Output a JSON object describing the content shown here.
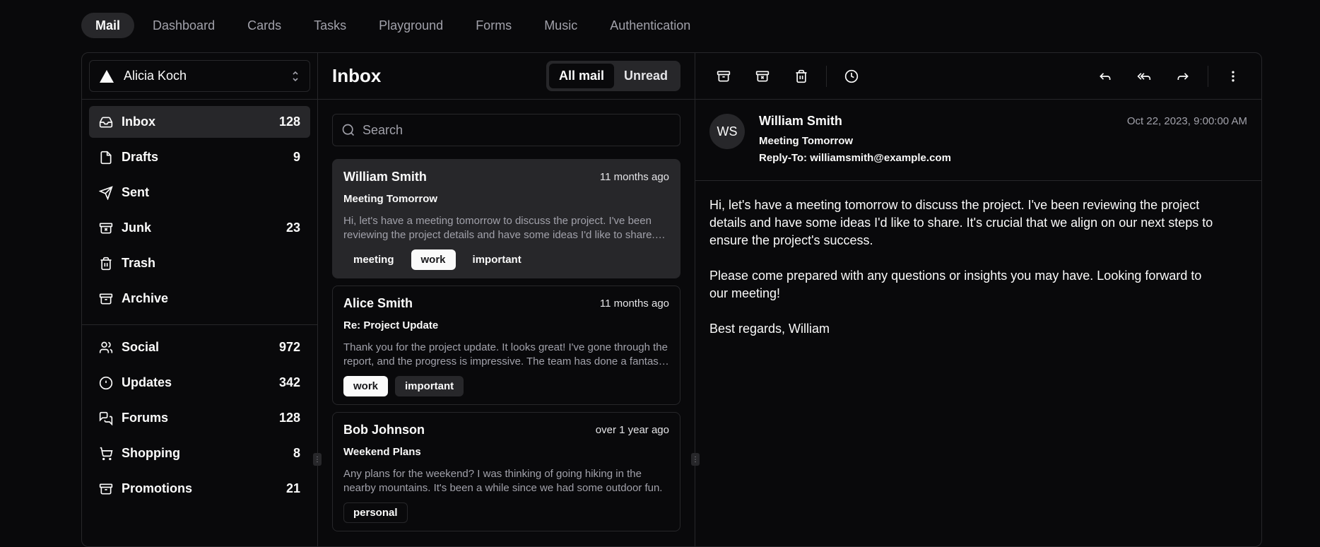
{
  "nav_tabs": [
    "Mail",
    "Dashboard",
    "Cards",
    "Tasks",
    "Playground",
    "Forms",
    "Music",
    "Authentication"
  ],
  "account": {
    "name": "Alicia Koch"
  },
  "sidebar": {
    "primary": [
      {
        "label": "Inbox",
        "count": "128",
        "icon": "inbox-icon"
      },
      {
        "label": "Drafts",
        "count": "9",
        "icon": "file-icon"
      },
      {
        "label": "Sent",
        "count": "",
        "icon": "send-icon"
      },
      {
        "label": "Junk",
        "count": "23",
        "icon": "archive-x-icon"
      },
      {
        "label": "Trash",
        "count": "",
        "icon": "trash-icon"
      },
      {
        "label": "Archive",
        "count": "",
        "icon": "archive-icon"
      }
    ],
    "secondary": [
      {
        "label": "Social",
        "count": "972",
        "icon": "users-icon"
      },
      {
        "label": "Updates",
        "count": "342",
        "icon": "alert-circle-icon"
      },
      {
        "label": "Forums",
        "count": "128",
        "icon": "messages-icon"
      },
      {
        "label": "Shopping",
        "count": "8",
        "icon": "cart-icon"
      },
      {
        "label": "Promotions",
        "count": "21",
        "icon": "archive-icon"
      }
    ]
  },
  "list": {
    "title": "Inbox",
    "toggle": {
      "all": "All mail",
      "unread": "Unread"
    },
    "search_placeholder": "Search",
    "mails": [
      {
        "from": "William Smith",
        "date": "11 months ago",
        "subject": "Meeting Tomorrow",
        "preview": "Hi, let's have a meeting tomorrow to discuss the project. I've been reviewing the project details and have some ideas I'd like to share. It's crucial that we align on our next steps to ensure the project's success.",
        "tags": [
          "meeting",
          "work",
          "important"
        ]
      },
      {
        "from": "Alice Smith",
        "date": "11 months ago",
        "subject": "Re: Project Update",
        "preview": "Thank you for the project update. It looks great! I've gone through the report, and the progress is impressive. The team has done a fantastic job, and I appreciate the hard work everyone has put in.",
        "tags": [
          "work",
          "important"
        ]
      },
      {
        "from": "Bob Johnson",
        "date": "over 1 year ago",
        "subject": "Weekend Plans",
        "preview": "Any plans for the weekend? I was thinking of going hiking in the nearby mountains. It's been a while since we had some outdoor fun.",
        "tags": [
          "personal"
        ]
      }
    ]
  },
  "reader": {
    "initials": "WS",
    "from": "William Smith",
    "subject": "Meeting Tomorrow",
    "reply_to": "Reply-To: williamsmith@example.com",
    "date": "Oct 22, 2023, 9:00:00 AM",
    "paragraphs": [
      "Hi, let's have a meeting tomorrow to discuss the project. I've been reviewing the project details and have some ideas I'd like to share. It's crucial that we align on our next steps to ensure the project's success.",
      "Please come prepared with any questions or insights you may have. Looking forward to our meeting!",
      "Best regards, William"
    ]
  }
}
